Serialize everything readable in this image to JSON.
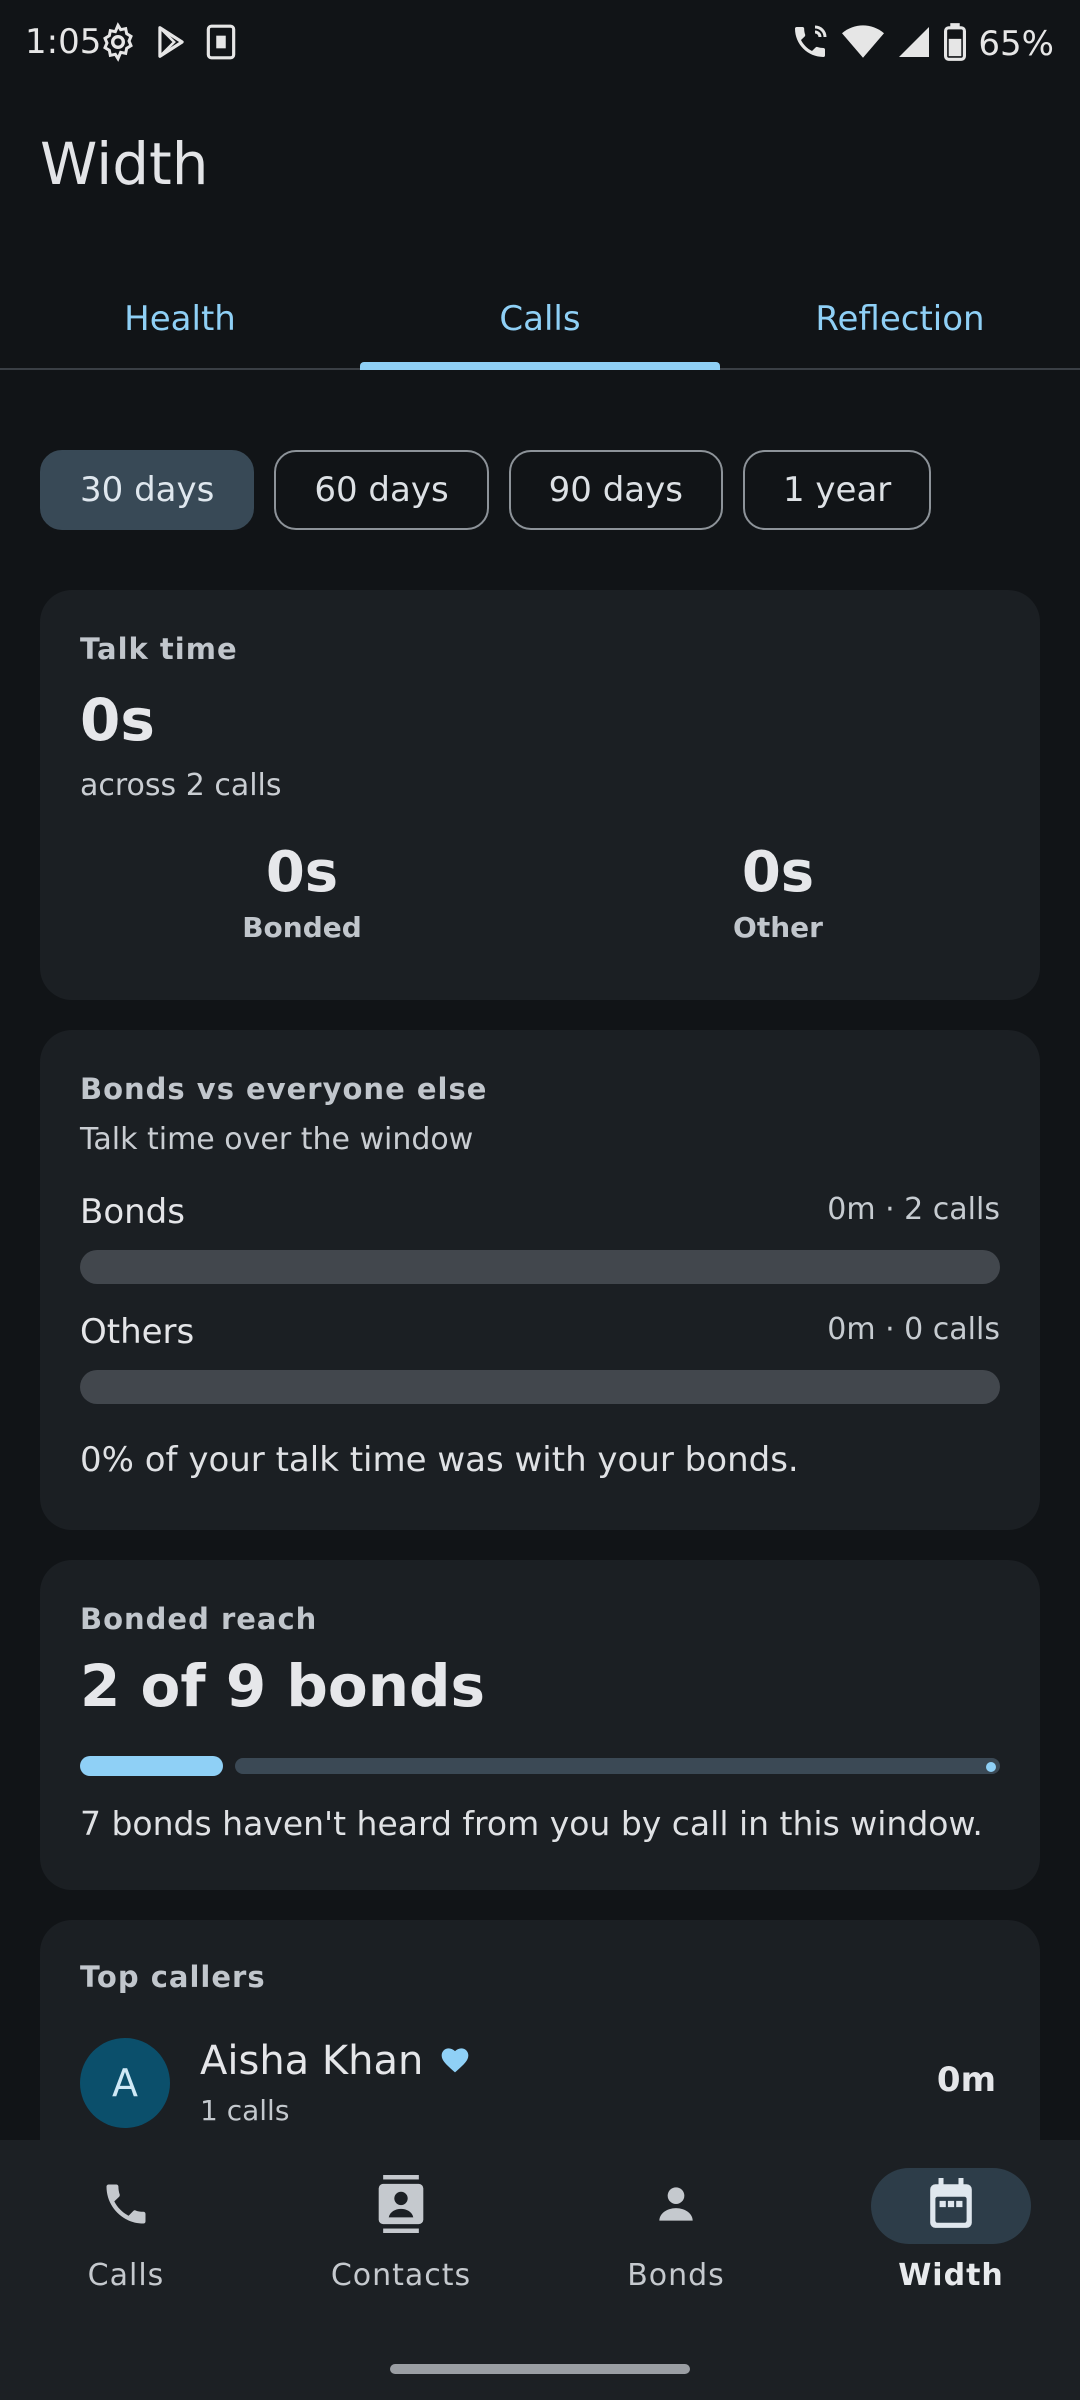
{
  "status_bar": {
    "time": "1:05",
    "battery_percent": "65%",
    "left_icons": [
      "gear-icon",
      "play-store-icon",
      "sim-card-icon"
    ],
    "right_icons": [
      "wifi-calling-icon",
      "wifi-icon",
      "signal-icon",
      "battery-icon"
    ]
  },
  "app_title": "Width",
  "tabs": [
    {
      "label": "Health",
      "active": false
    },
    {
      "label": "Calls",
      "active": true
    },
    {
      "label": "Reflection",
      "active": false
    }
  ],
  "range_chips": [
    {
      "label": "30 days",
      "selected": true
    },
    {
      "label": "60 days",
      "selected": false
    },
    {
      "label": "90 days",
      "selected": false
    },
    {
      "label": "1 year",
      "selected": false
    }
  ],
  "talk_time": {
    "label": "Talk time",
    "value": "0s",
    "sub": "across 2 calls",
    "bonded_value": "0s",
    "bonded_label": "Bonded",
    "other_value": "0s",
    "other_label": "Other"
  },
  "bonds_vs": {
    "label": "Bonds vs everyone else",
    "sub": "Talk time over the window",
    "bonds_label": "Bonds",
    "bonds_meta": "0m · 2 calls",
    "bonds_fraction": 0,
    "others_label": "Others",
    "others_meta": "0m · 0 calls",
    "others_fraction": 0,
    "summary": "0% of your talk time was with your bonds."
  },
  "bonded_reach": {
    "label": "Bonded reach",
    "value": "2 of 9 bonds",
    "reached": 2,
    "total": 9,
    "note": "7 bonds haven't heard from you by call in this window."
  },
  "top_callers": {
    "label": "Top callers",
    "items": [
      {
        "initial": "A",
        "name": "Aisha Khan",
        "sub": "1 calls",
        "time": "0m",
        "bonded": true
      }
    ]
  },
  "bottom_nav": [
    {
      "label": "Calls",
      "icon": "phone-icon",
      "active": false
    },
    {
      "label": "Contacts",
      "icon": "contacts-icon",
      "active": false
    },
    {
      "label": "Bonds",
      "icon": "person-icon",
      "active": false
    },
    {
      "label": "Width",
      "icon": "calendar-icon",
      "active": true
    }
  ],
  "colors": {
    "accent": "#8fd0f6",
    "background": "#111417",
    "card": "#1b1f23"
  }
}
